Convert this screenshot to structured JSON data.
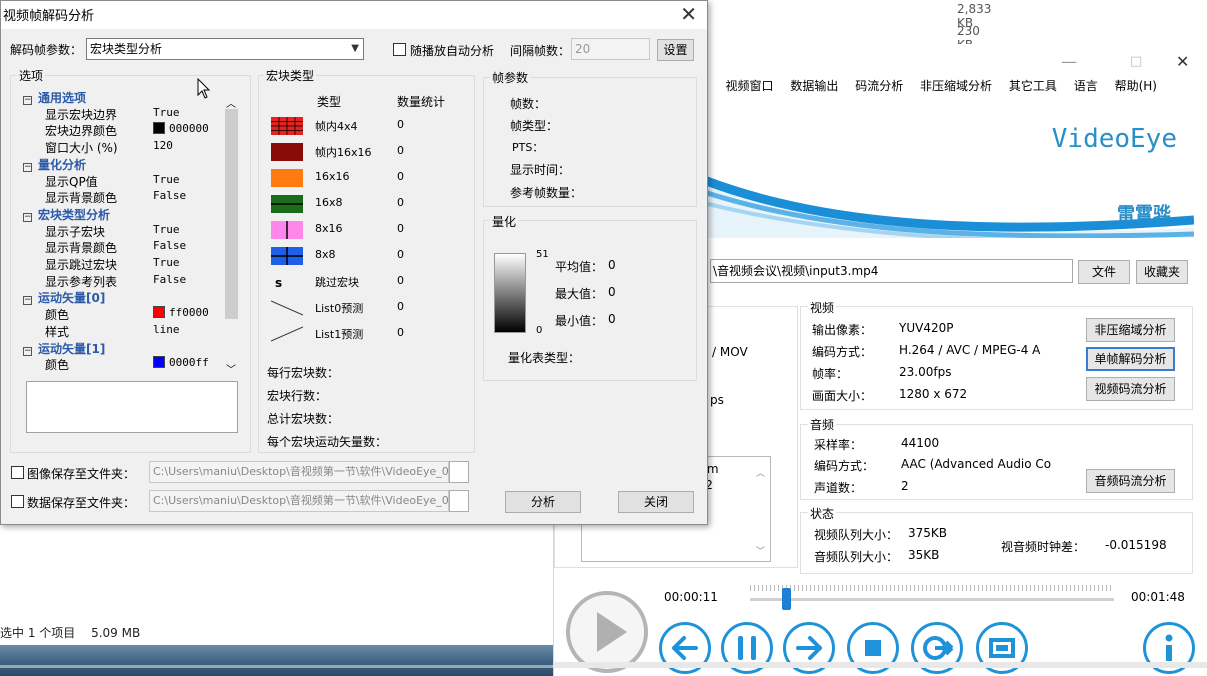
{
  "explorer": {
    "sizes": [
      "2,833 KB",
      "230 KB"
    ],
    "status_selected": "选中 1 个项目",
    "status_size": "5.09 MB"
  },
  "videoeye": {
    "window_buttons": [
      "—",
      "□",
      "✕"
    ],
    "menu": [
      ")",
      "视频窗口",
      "数据输出",
      "码流分析",
      "非压缩域分析",
      "其它工具",
      "语言",
      "帮助(H)"
    ],
    "brand": "VideoEye",
    "author": "雷霄骅",
    "path": "\\音视频会议\\视频\\input3.mp4",
    "file_button": "文件",
    "favorites_button": "收藏夹",
    "partial_texts": [
      "/ MOV",
      "ps",
      "isom",
      "512"
    ],
    "video": {
      "title": "视频",
      "pixel_label": "输出像素：",
      "pixel_value": "YUV420P",
      "codec_label": "编码方式：",
      "codec_value": "H.264 / AVC / MPEG-4 A",
      "fps_label": "帧率：",
      "fps_value": "23.00fps",
      "size_label": "画面大小：",
      "size_value": "1280 x 672"
    },
    "video_buttons": [
      "非压缩域分析",
      "单帧解码分析",
      "视频码流分析"
    ],
    "audio": {
      "title": "音频",
      "rate_label": "采样率：",
      "rate_value": "44100",
      "codec_label": "编码方式：",
      "codec_value": "AAC (Advanced Audio Co",
      "channels_label": "声道数：",
      "channels_value": "2"
    },
    "audio_button": "音频码流分析",
    "status": {
      "title": "状态",
      "vq_label": "视频队列大小：",
      "vq_value": "375KB",
      "aq_label": "音频队列大小：",
      "aq_value": "35KB",
      "diff_label": "视音频时钟差：",
      "diff_value": "-0.015198"
    },
    "time_current": "00:00:11",
    "time_total": "00:01:48",
    "seek_fraction": 0.1
  },
  "dialog": {
    "title": "视频帧解码分析",
    "close": "✕",
    "param_label": "解码帧参数：",
    "param_value": "宏块类型分析",
    "auto_label": "随播放自动分析",
    "interval_label": "间隔帧数：",
    "interval_value": "20",
    "set_button": "设置",
    "options_title": "选项",
    "tree": [
      {
        "type": "cat",
        "label": "通用选项"
      },
      {
        "type": "item",
        "label": "显示宏块边界",
        "value": "True"
      },
      {
        "type": "item",
        "label": "宏块边界颜色",
        "value": "000000",
        "color": "#000000"
      },
      {
        "type": "item",
        "label": "窗口大小 (%)",
        "value": "120"
      },
      {
        "type": "cat",
        "label": "量化分析"
      },
      {
        "type": "item",
        "label": "显示QP值",
        "value": "True"
      },
      {
        "type": "item",
        "label": "显示背景颜色",
        "value": "False"
      },
      {
        "type": "cat",
        "label": "宏块类型分析"
      },
      {
        "type": "item",
        "label": "显示子宏块",
        "value": "True"
      },
      {
        "type": "item",
        "label": "显示背景颜色",
        "value": "False"
      },
      {
        "type": "item",
        "label": "显示跳过宏块",
        "value": "True"
      },
      {
        "type": "item",
        "label": "显示参考列表",
        "value": "False"
      },
      {
        "type": "cat",
        "label": "运动矢量[0]"
      },
      {
        "type": "item",
        "label": "颜色",
        "value": "ff0000",
        "color": "#ff0000"
      },
      {
        "type": "item",
        "label": "样式",
        "value": "line"
      },
      {
        "type": "cat",
        "label": "运动矢量[1]"
      },
      {
        "type": "item",
        "label": "颜色",
        "value": "0000ff",
        "color": "#0000ff"
      }
    ],
    "mb_title": "宏块类型",
    "mb_col_type": "类型",
    "mb_col_count": "数量统计",
    "mb_types": [
      {
        "name": "帧内4x4",
        "count": "0",
        "icon": "grid4",
        "color": "#e8231f"
      },
      {
        "name": "帧内16x16",
        "count": "0",
        "icon": "solid",
        "color": "#8b0b0b"
      },
      {
        "name": "16x16",
        "count": "0",
        "icon": "solid",
        "color": "#ff7a10"
      },
      {
        "name": "16x8",
        "count": "0",
        "icon": "hsplit",
        "color": "#1a6b1a"
      },
      {
        "name": "8x16",
        "count": "0",
        "icon": "vsplit",
        "color": "#ff86ea"
      },
      {
        "name": "8x8",
        "count": "0",
        "icon": "quad",
        "color": "#1f5fe8"
      },
      {
        "name": "跳过宏块",
        "count": "0",
        "icon": "s",
        "color": "#000000"
      },
      {
        "name": "List0预测",
        "count": "0",
        "icon": "line-down",
        "color": "#000000"
      },
      {
        "name": "List1预测",
        "count": "0",
        "icon": "line-up",
        "color": "#000000"
      }
    ],
    "mb_stats": [
      "每行宏块数：",
      "宏块行数：",
      "总计宏块数：",
      "每个宏块运动矢量数："
    ],
    "frame_title": "帧参数",
    "frame_fields": [
      "帧数：",
      "帧类型：",
      "PTS：",
      "显示时间：",
      "参考帧数量："
    ],
    "quant_title": "量化",
    "quant_max": "51",
    "quant_min": "0",
    "quant_fields": [
      {
        "label": "平均值：",
        "value": "0"
      },
      {
        "label": "最大值：",
        "value": "0"
      },
      {
        "label": "最小值：",
        "value": "0"
      }
    ],
    "quant_table_label": "量化表类型：",
    "save_image_label": "图像保存至文件夹：",
    "save_image_path": "C:\\Users\\maniu\\Desktop\\音视频第一节\\软件\\VideoEye_0",
    "save_data_label": "数据保存至文件夹：",
    "save_data_path": "C:\\Users\\maniu\\Desktop\\音视频第一节\\软件\\VideoEye_0",
    "analyze_button": "分析",
    "close_button": "关闭"
  }
}
